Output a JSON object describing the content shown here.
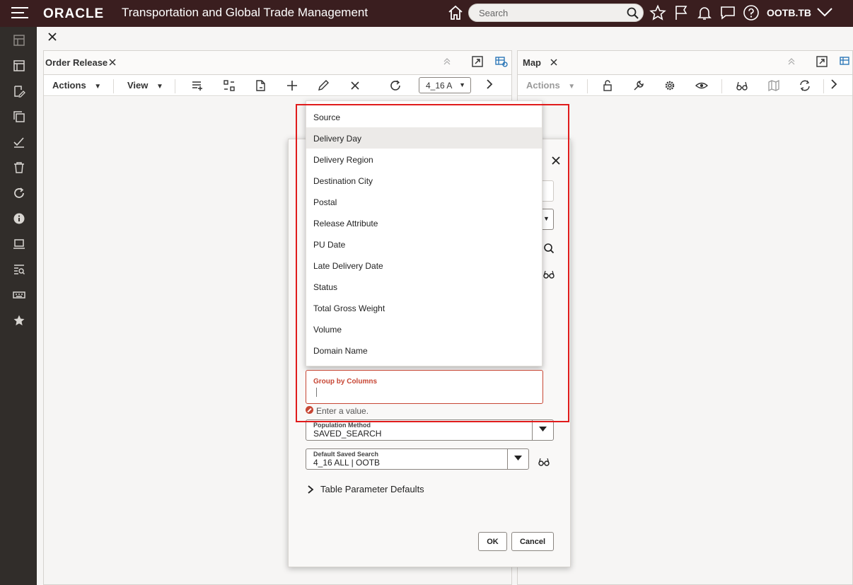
{
  "header": {
    "logo": "ORACLE",
    "app_title": "Transportation and Global Trade Management",
    "search_placeholder": "Search",
    "user": "OOTB.TB"
  },
  "sidebar": {
    "icons": [
      "dashboard-icon",
      "layout-icon",
      "edit-doc-icon",
      "copy-icon",
      "checklist-icon",
      "trash-icon",
      "refresh-icon",
      "info-icon",
      "monitor-icon",
      "search-list-icon",
      "keyboard-icon",
      "star-icon"
    ]
  },
  "left_panel": {
    "title": "Order Release",
    "toolbar": {
      "actions_label": "Actions",
      "view_label": "View",
      "saved_search_value": "4_16 A"
    }
  },
  "right_panel": {
    "title": "Map",
    "toolbar": {
      "actions_label": "Actions"
    }
  },
  "dropdown": {
    "items": [
      "Source",
      "Delivery Day",
      "Delivery Region",
      "Destination City",
      "Postal",
      "Release Attribute",
      "PU Date",
      "Late Delivery Date",
      "Status",
      "Total Gross Weight",
      "Volume",
      "Domain Name"
    ],
    "highlighted_item": "Delivery Day"
  },
  "dialog": {
    "group_by": {
      "label": "Group by Columns",
      "error": "Enter a value."
    },
    "population_method": {
      "label": "Population Method",
      "value": "SAVED_SEARCH"
    },
    "default_saved_search": {
      "label": "Default Saved Search",
      "value": "4_16 ALL | OOTB"
    },
    "section": "Table Parameter Defaults",
    "ok_label": "OK",
    "cancel_label": "Cancel"
  },
  "colors": {
    "header_bg": "#3a1e1f",
    "sidebar_bg": "#312d2a",
    "error": "#c74634",
    "highlight_box": "#e01b1b"
  }
}
